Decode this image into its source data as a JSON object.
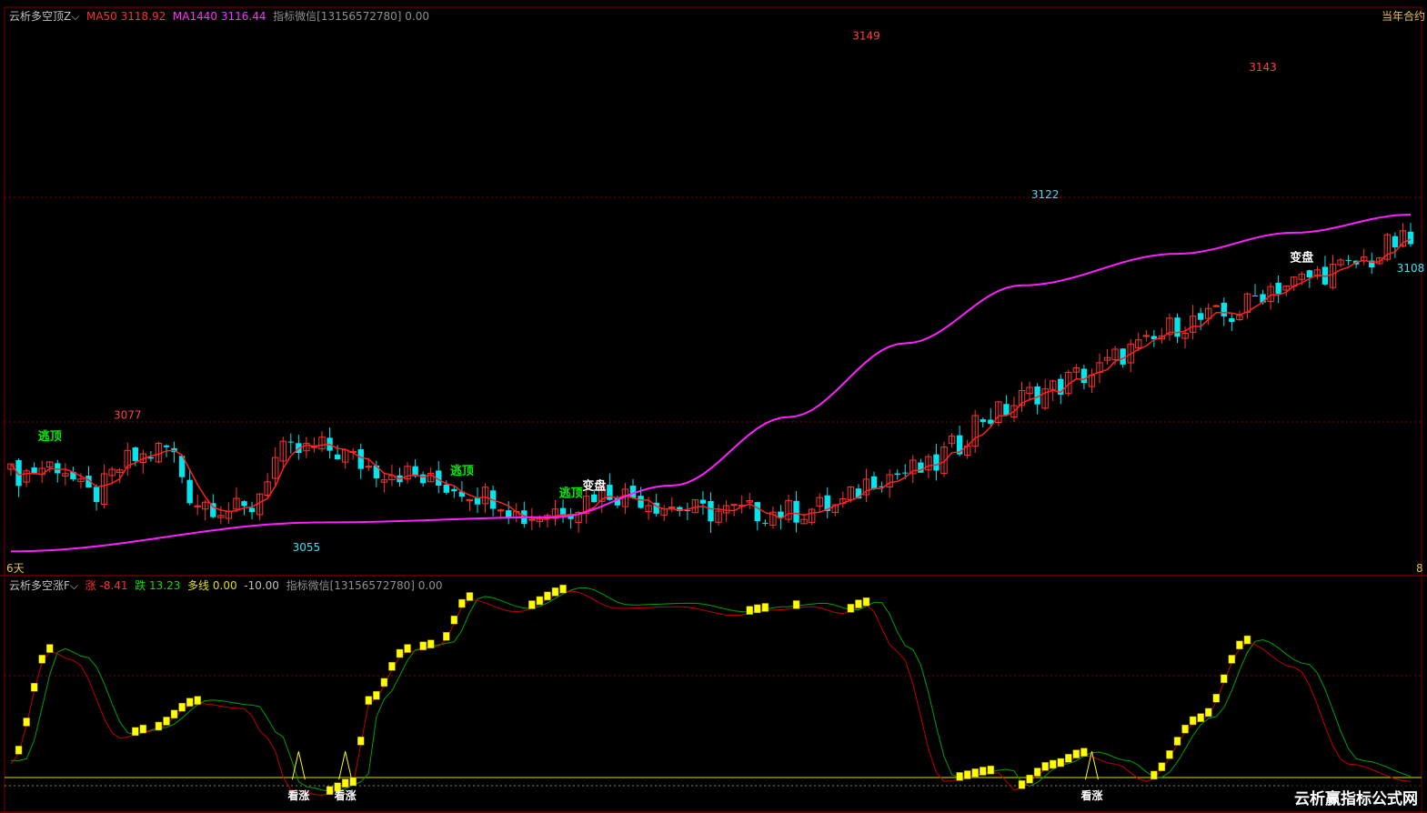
{
  "header_top": {
    "indicator_name": "云析多空顶Z",
    "ma50_label": "MA50",
    "ma50_value": "3118.92",
    "ma1440_label": "MA1440",
    "ma1440_value": "3116.44",
    "wechat_text": "指标微信[13156572780] 0.00",
    "right_label": "当年合约"
  },
  "header_bottom": {
    "indicator_name": "云析多空涨F",
    "up_label": "涨",
    "up_value": "-8.41",
    "down_label": "跌",
    "down_value": "13.23",
    "multi_label": "多线",
    "multi_value": "0.00",
    "neg_value": "-10.00",
    "wechat_text": "指标微信[13156572780] 0.00"
  },
  "axis": {
    "left_label": "6天",
    "right_label": "8"
  },
  "watermark": "云析赢指标公式网",
  "colors": {
    "up_candle": "#ff3232",
    "down_candle": "#00e5ee",
    "ma50": "#ff2020",
    "ma1440": "#ff20ff",
    "signal_green": "#00ee00",
    "signal_white": "#ffffff",
    "osc_yellow": "#ffff00",
    "osc_red": "#c00000",
    "osc_green": "#00a000",
    "grid": "#800000"
  },
  "chart_data": [
    {
      "type": "candlestick",
      "ylim": [
        3051,
        3152
      ],
      "x_count": 181,
      "price_path": [
        [
          0,
          3067
        ],
        [
          6,
          3069
        ],
        [
          10,
          3063
        ],
        [
          16,
          3070
        ],
        [
          20,
          3072
        ],
        [
          24,
          3062
        ],
        [
          30,
          3060
        ],
        [
          35,
          3071
        ],
        [
          40,
          3072
        ],
        [
          48,
          3068
        ],
        [
          56,
          3065
        ],
        [
          62,
          3063
        ],
        [
          66,
          3059
        ],
        [
          72,
          3061
        ],
        [
          76,
          3064
        ],
        [
          80,
          3063
        ],
        [
          85,
          3061
        ],
        [
          89,
          3060
        ],
        [
          93,
          3060
        ],
        [
          100,
          3060
        ],
        [
          106,
          3061
        ],
        [
          112,
          3067
        ],
        [
          118,
          3068
        ],
        [
          121,
          3072
        ],
        [
          125,
          3078
        ],
        [
          133,
          3083
        ],
        [
          138,
          3086
        ],
        [
          145,
          3091
        ],
        [
          151,
          3096
        ],
        [
          156,
          3097
        ],
        [
          163,
          3103
        ],
        [
          171,
          3106
        ],
        [
          175,
          3108
        ],
        [
          178,
          3111
        ]
      ],
      "x_path": [
        [
          0,
          2
        ],
        [
          6,
          7
        ],
        [
          10,
          11
        ],
        [
          16,
          17
        ],
        [
          20,
          21
        ],
        [
          24,
          25
        ],
        [
          30,
          31
        ],
        [
          35,
          35
        ],
        [
          40,
          40
        ],
        [
          48,
          47
        ],
        [
          56,
          54
        ],
        [
          62,
          60
        ],
        [
          66,
          64
        ],
        [
          72,
          69
        ],
        [
          76,
          72
        ],
        [
          80,
          75
        ],
        [
          85,
          79
        ],
        [
          89,
          83
        ],
        [
          93,
          87
        ],
        [
          100,
          93
        ],
        [
          106,
          98
        ],
        [
          112,
          103
        ],
        [
          118,
          108
        ],
        [
          121,
          111
        ],
        [
          125,
          114
        ],
        [
          133,
          121
        ],
        [
          138,
          125
        ],
        [
          145,
          131
        ],
        [
          151,
          136
        ],
        [
          156,
          141
        ],
        [
          163,
          147
        ],
        [
          171,
          154
        ],
        [
          175,
          158
        ],
        [
          178,
          180
        ]
      ],
      "annotations": [
        {
          "text": "逃顶",
          "x": 5,
          "anchor": "high",
          "kind": "sell"
        },
        {
          "text": "3077",
          "x": 15,
          "value": 3077,
          "kind": "high"
        },
        {
          "text": "3055",
          "x": 38,
          "value": 3055,
          "kind": "low"
        },
        {
          "text": "逃顶",
          "x": 58,
          "anchor": "high",
          "kind": "sell"
        },
        {
          "text": "逃顶",
          "x": 72,
          "anchor": "high",
          "kind": "sell"
        },
        {
          "text": "变盘",
          "x": 75,
          "anchor": "mid",
          "kind": "turn"
        },
        {
          "text": "3149",
          "x": 110,
          "value": 3149,
          "kind": "high"
        },
        {
          "text": "3122",
          "x": 133,
          "value": 3122,
          "kind": "low"
        },
        {
          "text": "3143",
          "x": 161,
          "value": 3143,
          "kind": "high"
        },
        {
          "text": "变盘",
          "x": 166,
          "anchor": "mid",
          "kind": "turn"
        },
        {
          "text": "3108",
          "x": 180,
          "value": 3108,
          "kind": "low"
        }
      ],
      "series": [
        {
          "name": "MA50",
          "value": 3118.92
        },
        {
          "name": "MA1440",
          "value": 3116.44
        }
      ]
    },
    {
      "type": "line",
      "ylim": [
        -12,
        110
      ],
      "x_count": 181,
      "osc_path": [
        [
          0,
          10
        ],
        [
          5,
          75
        ],
        [
          8,
          70
        ],
        [
          14,
          25
        ],
        [
          18,
          29
        ],
        [
          24,
          45
        ],
        [
          30,
          42
        ],
        [
          33,
          25
        ],
        [
          36,
          -5
        ],
        [
          40,
          -8
        ],
        [
          44,
          -2
        ],
        [
          46,
          45
        ],
        [
          51,
          75
        ],
        [
          55,
          78
        ],
        [
          59,
          105
        ],
        [
          65,
          98
        ],
        [
          72,
          110
        ],
        [
          78,
          100
        ],
        [
          86,
          101
        ],
        [
          93,
          96
        ],
        [
          98,
          99
        ],
        [
          103,
          101
        ],
        [
          107,
          97
        ],
        [
          110,
          102
        ],
        [
          114,
          75
        ],
        [
          120,
          0
        ],
        [
          127,
          5
        ],
        [
          129,
          -5
        ],
        [
          134,
          8
        ],
        [
          138,
          15
        ],
        [
          142,
          10
        ],
        [
          146,
          0
        ],
        [
          153,
          35
        ],
        [
          159,
          80
        ],
        [
          165,
          66
        ],
        [
          172,
          10
        ],
        [
          180,
          0
        ]
      ],
      "markers": [
        {
          "text": "看涨",
          "x": 37
        },
        {
          "text": "看涨",
          "x": 43
        },
        {
          "text": "看涨",
          "x": 139
        }
      ]
    }
  ]
}
